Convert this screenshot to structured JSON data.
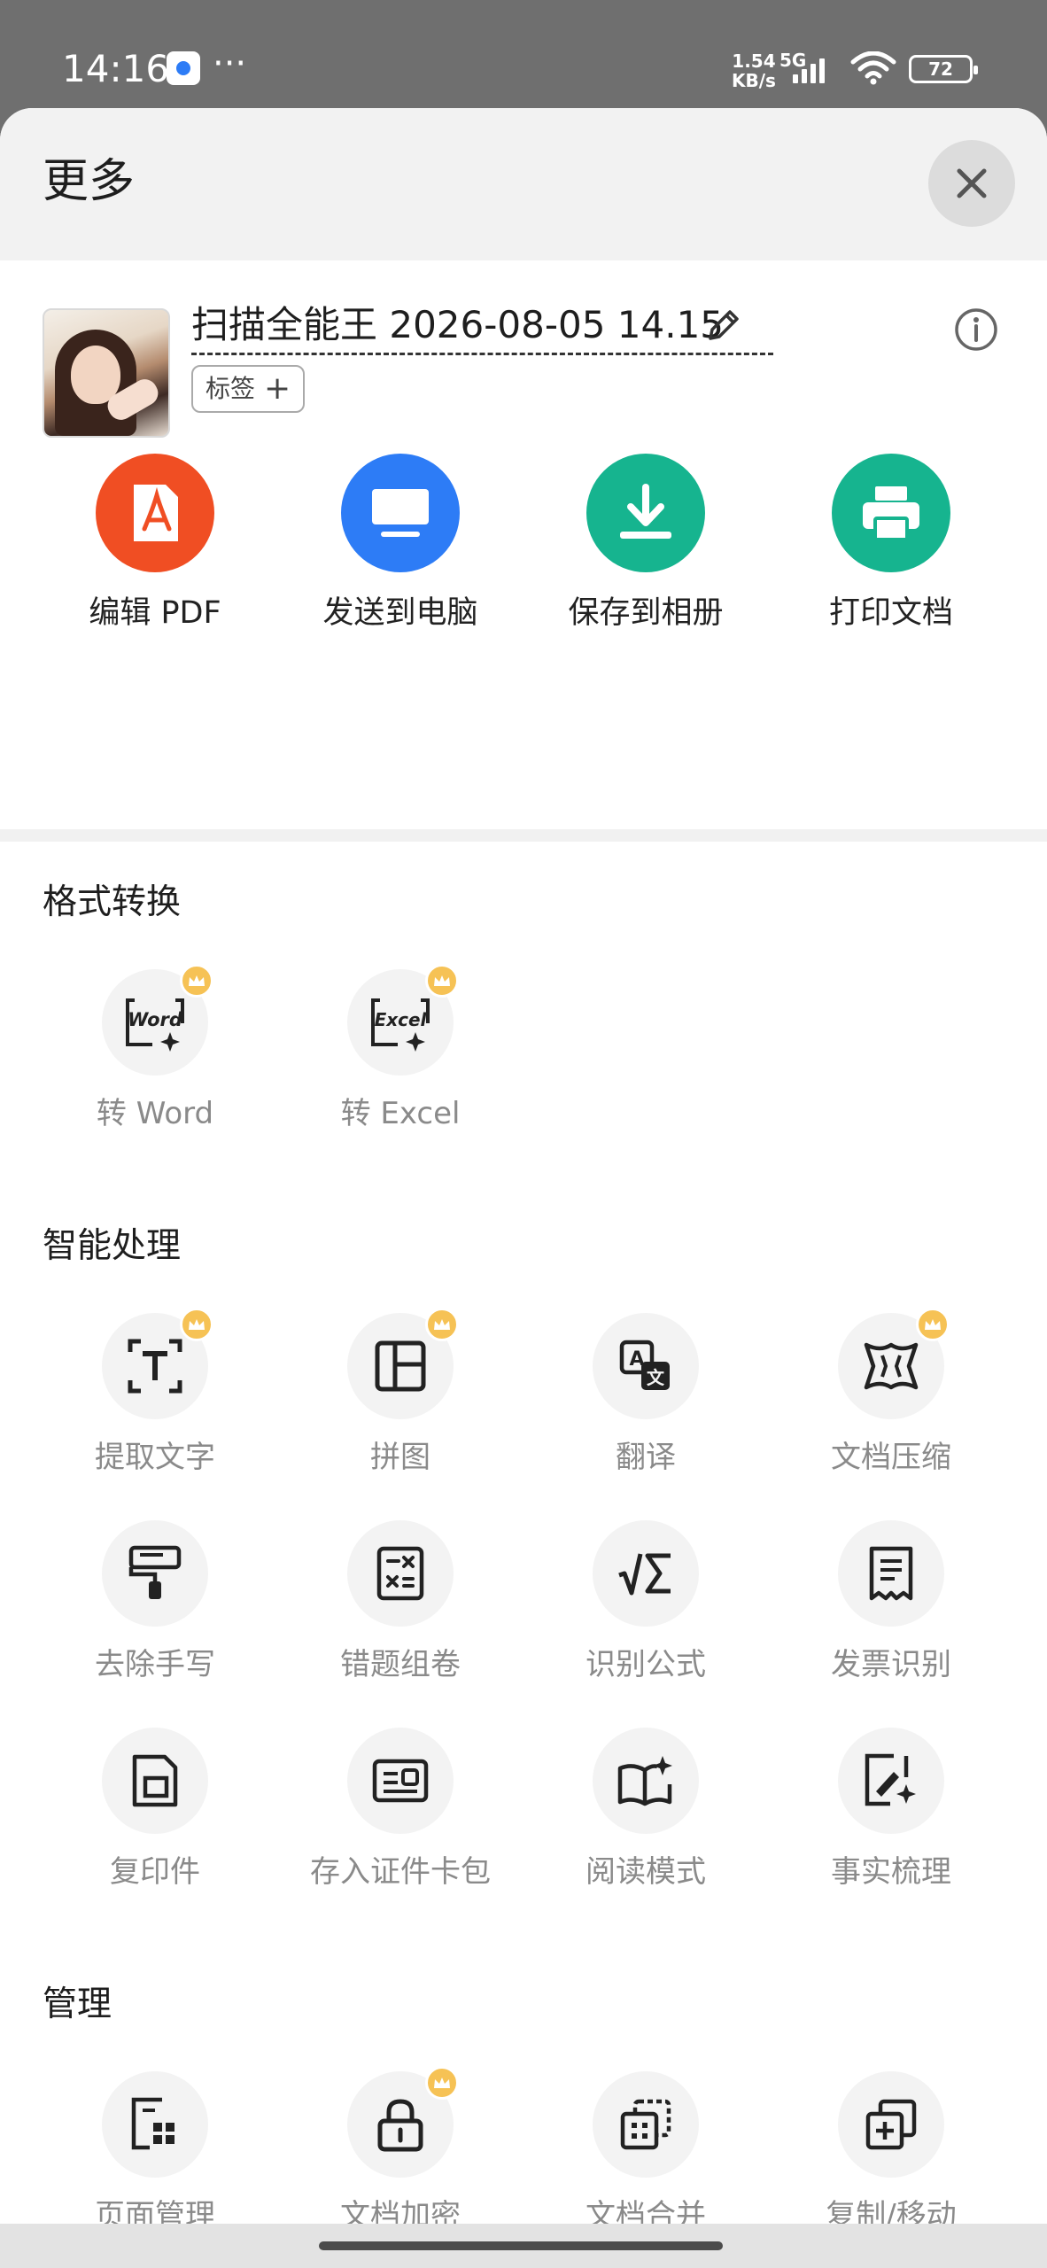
{
  "status_bar": {
    "time": "14:16",
    "speed_value": "1.54",
    "speed_unit": "KB/s",
    "network": "5G",
    "battery": "72",
    "icons": [
      "app-notification-icon",
      "more-dots-icon",
      "signal-icon",
      "wifi-icon",
      "battery-icon"
    ]
  },
  "header": {
    "title": "更多"
  },
  "document": {
    "name": "扫描全能王 2026-08-05 14.15",
    "tag_label": "标签",
    "tag_plus": "+"
  },
  "actions": [
    {
      "label": "编辑 PDF",
      "color": "#f04e23",
      "icon": "pdf-icon"
    },
    {
      "label": "发送到电脑",
      "color": "#2d7cf6",
      "icon": "monitor-icon"
    },
    {
      "label": "保存到相册",
      "color": "#16b48f",
      "icon": "download-icon"
    },
    {
      "label": "打印文档",
      "color": "#16b48f",
      "icon": "printer-icon"
    }
  ],
  "sections": {
    "format": {
      "title": "格式转换",
      "items": [
        {
          "label": "转 Word",
          "premium": true
        },
        {
          "label": "转 Excel",
          "premium": true
        }
      ]
    },
    "smart": {
      "title": "智能处理",
      "items": [
        {
          "label": "提取文字",
          "premium": true
        },
        {
          "label": "拼图",
          "premium": true
        },
        {
          "label": "翻译",
          "premium": false
        },
        {
          "label": "文档压缩",
          "premium": true
        },
        {
          "label": "去除手写",
          "premium": false
        },
        {
          "label": "错题组卷",
          "premium": false
        },
        {
          "label": "识别公式",
          "premium": false
        },
        {
          "label": "发票识别",
          "premium": false
        },
        {
          "label": "复印件",
          "premium": false
        },
        {
          "label": "存入证件卡包",
          "premium": false
        },
        {
          "label": "阅读模式",
          "premium": false
        },
        {
          "label": "事实梳理",
          "premium": false
        }
      ]
    },
    "manage": {
      "title": "管理",
      "items": [
        {
          "label": "页面管理",
          "premium": false
        },
        {
          "label": "文档加密",
          "premium": true
        },
        {
          "label": "文档合并",
          "premium": false
        },
        {
          "label": "复制/移动",
          "premium": false
        }
      ]
    }
  },
  "icon_text": {
    "word": "Word",
    "excel": "Excel"
  },
  "colors": {
    "premium_crown": "#f6c255",
    "icon_bg": "#f3f3f3"
  }
}
